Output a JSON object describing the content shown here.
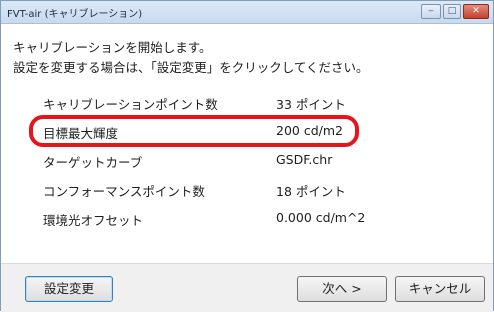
{
  "window": {
    "title": "FVT-air (キャリブレーション)",
    "controls": {
      "minimize": "‒",
      "maximize": "□",
      "close": "✕"
    }
  },
  "messages": {
    "line1": "キャリブレーションを開始します。",
    "line2": "設定を変更する場合は、「設定変更」をクリックしてください。"
  },
  "settings": [
    {
      "label": "キャリブレーションポイント数",
      "value": "33 ポイント"
    },
    {
      "label": "目標最大輝度",
      "value": "200 cd/m2",
      "highlighted": true
    },
    {
      "label": "ターゲットカーブ",
      "value": "GSDF.chr"
    },
    {
      "label": "コンフォーマンスポイント数",
      "value": "18 ポイント"
    },
    {
      "label": "環境光オフセット",
      "value": "0.000 cd/m^2"
    }
  ],
  "buttons": {
    "change_settings": "設定変更",
    "next": "次へ >",
    "cancel": "キャンセル"
  },
  "colors": {
    "highlight": "#e8141c",
    "titlebar": "#c8daf0",
    "footer": "#f0f0f0"
  }
}
